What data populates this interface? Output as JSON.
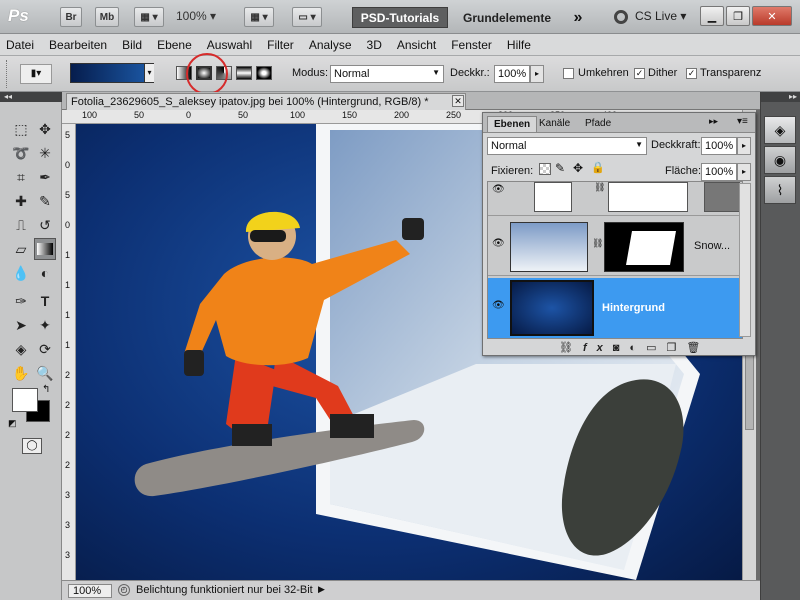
{
  "appbar": {
    "logo": "Ps",
    "bridge": "Br",
    "minibridge": "Mb",
    "zoom": "100%",
    "workspace_active": "PSD-Tutorials",
    "workspace_2": "Grundelemente",
    "more": "»",
    "cslive": "CS Live"
  },
  "menu": [
    "Datei",
    "Bearbeiten",
    "Bild",
    "Ebene",
    "Auswahl",
    "Filter",
    "Analyse",
    "3D",
    "Ansicht",
    "Fenster",
    "Hilfe"
  ],
  "options": {
    "mode_label": "Modus:",
    "mode_value": "Normal",
    "opacity_label": "Deckkr.:",
    "opacity_value": "100%",
    "reverse_label": "Umkehren",
    "reverse_checked": false,
    "dither_label": "Dither",
    "dither_checked": true,
    "transparency_label": "Transparenz",
    "transparency_checked": true,
    "highlight_color": "#d62b2b"
  },
  "document": {
    "tab_title": "Fotolia_23629605_S_aleksey ipatov.jpg bei 100% (Hintergrund, RGB/8) *",
    "ruler_h": [
      "100",
      "50",
      "0",
      "50",
      "100",
      "150",
      "200",
      "250",
      "300",
      "350",
      "400"
    ],
    "ruler_v": [
      "5",
      "0",
      "5",
      "0",
      "1",
      "1",
      "1",
      "1",
      "2",
      "2",
      "2",
      "2",
      "3",
      "3",
      "3"
    ]
  },
  "status": {
    "zoom": "100%",
    "message": "Belichtung funktioniert nur bei 32-Bit"
  },
  "layers_panel": {
    "tabs": [
      "Ebenen",
      "Kanäle",
      "Pfade"
    ],
    "blend": "Normal",
    "opacity_label": "Deckkraft:",
    "opacity_value": "100%",
    "lock_label": "Fixieren:",
    "fill_label": "Fläche:",
    "fill_value": "100%",
    "layers": [
      {
        "name": "",
        "selected": false
      },
      {
        "name": "Snow...",
        "selected": false
      },
      {
        "name": "Hintergrund",
        "selected": true
      }
    ]
  },
  "colors": {
    "selection": "#3d9af0",
    "canvas_blue": "#0c2f72"
  }
}
